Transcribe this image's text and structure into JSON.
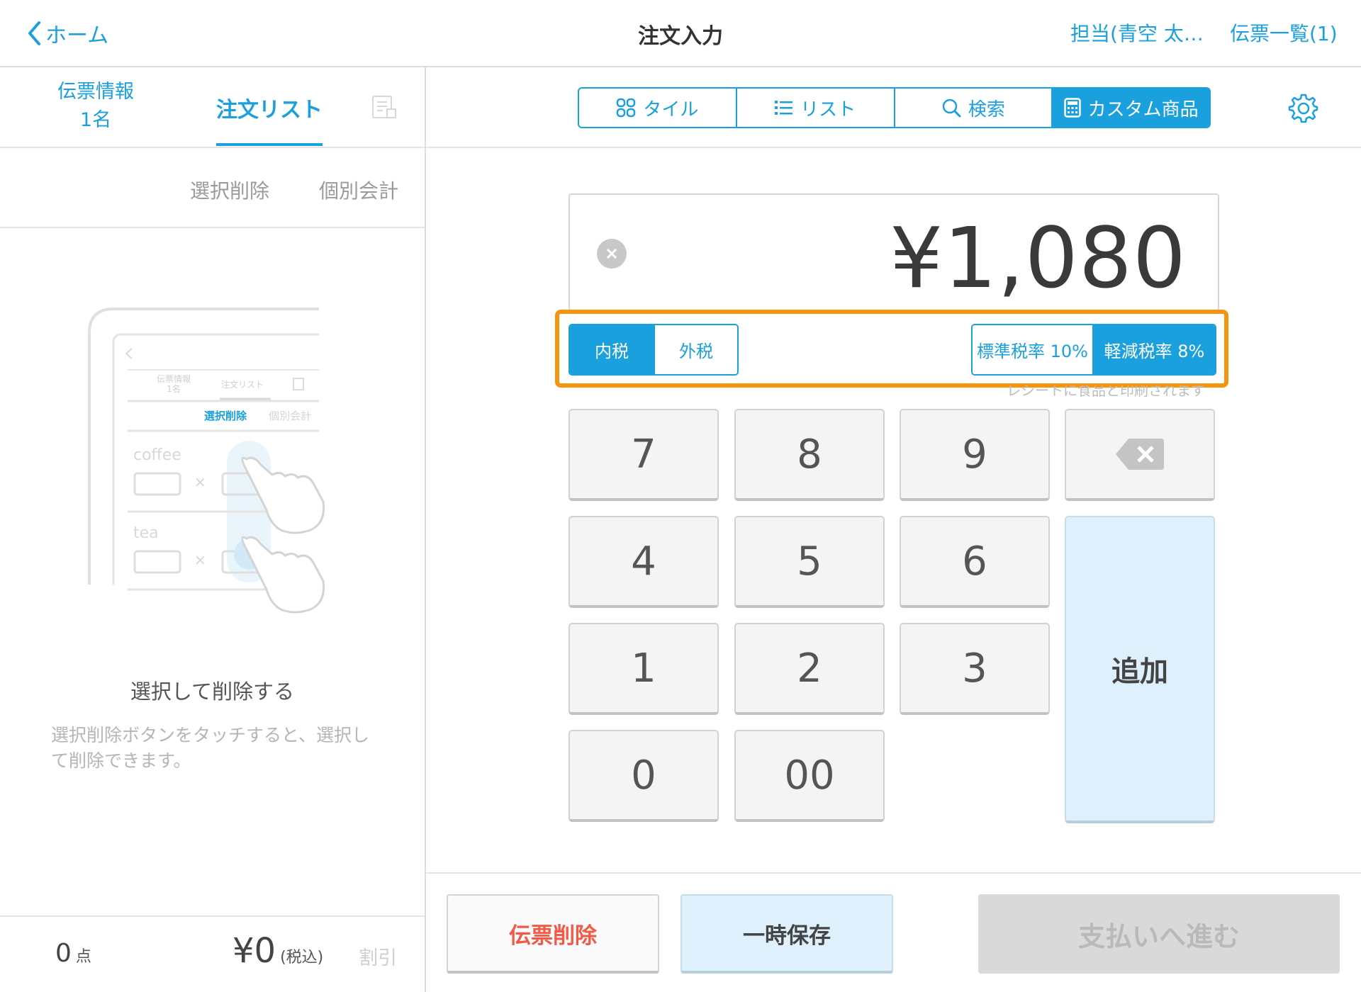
{
  "header": {
    "back_label": "ホーム",
    "title": "注文入力",
    "staff_label": "担当(青空 太…",
    "slip_list_label": "伝票一覧(1)"
  },
  "left_panel": {
    "tab_slip_info_line1": "伝票情報",
    "tab_slip_info_line2": "1名",
    "tab_order_list": "注文リスト",
    "select_delete": "選択削除",
    "individual_checkout": "個別会計",
    "illustration": {
      "tab1_line1": "伝票情報",
      "tab1_line2": "1名",
      "tab2": "注文リスト",
      "select_delete": "選択削除",
      "individual_checkout": "個別会計",
      "item1": "coffee",
      "item2": "tea",
      "times": "×"
    },
    "heading": "選択して削除する",
    "description": "選択削除ボタンをタッチすると、選択して削除できます。",
    "footer": {
      "count": "0",
      "count_unit": "点",
      "total": "¥0",
      "total_unit": "(税込)",
      "discount": "割引"
    }
  },
  "view_tabs": [
    {
      "label": "タイル",
      "icon": "tile-grid-icon"
    },
    {
      "label": "リスト",
      "icon": "list-icon"
    },
    {
      "label": "検索",
      "icon": "search-icon"
    },
    {
      "label": "カスタム商品",
      "icon": "calculator-icon"
    }
  ],
  "display": {
    "amount": "¥1,080"
  },
  "tax": {
    "included": "内税",
    "excluded": "外税",
    "standard_rate": "標準税率 10%",
    "reduced_rate": "軽減税率 8%",
    "receipt_note": "レシートに食品と印刷されます"
  },
  "keypad": {
    "k7": "7",
    "k8": "8",
    "k9": "9",
    "k4": "4",
    "k5": "5",
    "k6": "6",
    "k1": "1",
    "k2": "2",
    "k3": "3",
    "k0": "0",
    "k00": "00",
    "add": "追加"
  },
  "bottom": {
    "delete_slip": "伝票削除",
    "temp_save": "一時保存",
    "proceed_payment": "支払いへ進む"
  },
  "colors": {
    "accent": "#1aa0dc",
    "highlight_border": "#f5940f",
    "danger_text": "#f05a47",
    "add_key_bg": "#ddf0fb"
  }
}
